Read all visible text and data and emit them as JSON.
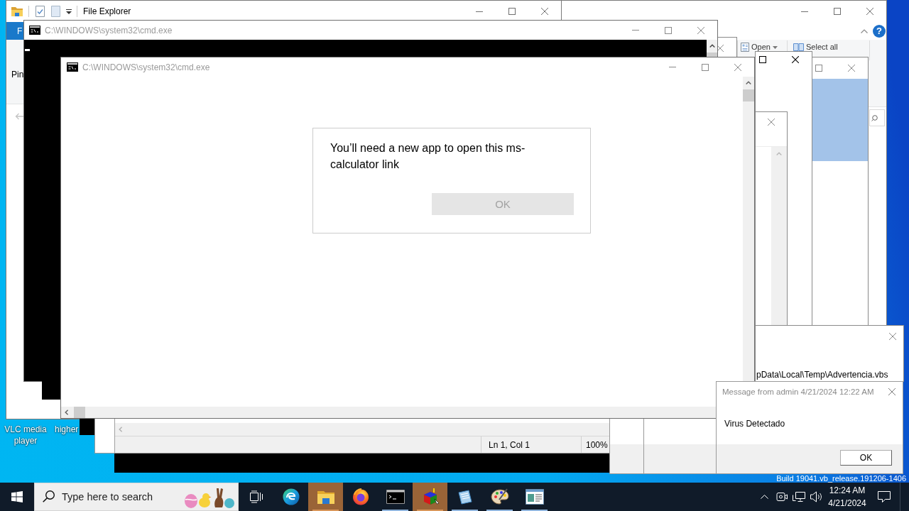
{
  "desktop": {
    "icons": [
      {
        "label": "VLC media player"
      },
      {
        "label": "higher"
      }
    ],
    "build_info": "Build 19041.vb_release.191206-1406"
  },
  "file_explorer": {
    "title": "File Explorer",
    "ribbon_tab": "F",
    "ribbon_label": "Pin"
  },
  "explorer_window": {
    "help": "?",
    "open_button": "Open",
    "select_all_button": "Select all"
  },
  "console_back": {
    "title": "C:\\WINDOWS\\system32\\cmd.exe"
  },
  "console_front": {
    "title": "C:\\WINDOWS\\system32\\cmd.exe"
  },
  "app_dialog": {
    "message": "You’ll need a new app to open this ms-calculator link",
    "button": {
      "label": "OK",
      "disabled": true
    }
  },
  "notepad_window": {
    "status": [
      "Ln 1, Col 1",
      "100%"
    ]
  },
  "script_window": {
    "path": "pData\\Local\\Temp\\Advertencia.vbs"
  },
  "message_box": {
    "title": "Message from admin 4/21/2024 12:22 AM",
    "body": "Virus Detectado",
    "button": "OK"
  },
  "taskbar": {
    "search": {
      "placeholder": "Type here to search"
    },
    "apps": [
      {
        "kind": "wave",
        "running": false,
        "attention": false
      },
      {
        "kind": "folder",
        "running": true,
        "attention": true
      },
      {
        "kind": "globe",
        "running": false,
        "attention": false
      },
      {
        "kind": "terminal",
        "running": true,
        "attention": false
      },
      {
        "kind": "cube",
        "running": true,
        "attention": true
      },
      {
        "kind": "notepad",
        "running": true,
        "attention": false
      },
      {
        "kind": "palette",
        "running": true,
        "attention": false
      },
      {
        "kind": "window",
        "running": true,
        "attention": false
      }
    ],
    "clock": {
      "time": "12:24 AM",
      "date": "4/21/2024"
    }
  }
}
